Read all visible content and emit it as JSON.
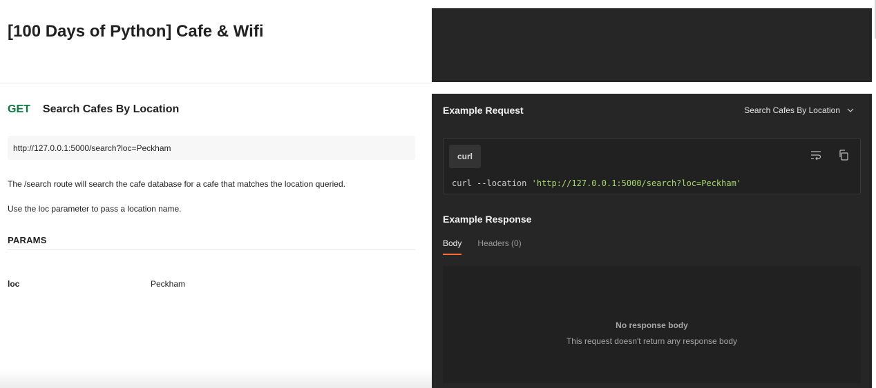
{
  "collection": {
    "title": "[100 Days of Python] Cafe & Wifi"
  },
  "request": {
    "method": "GET",
    "name": "Search Cafes By Location",
    "url": "http://127.0.0.1:5000/search?loc=Peckham",
    "description": [
      "The /search route will search the cafe database for a cafe that matches the location queried.",
      "Use the loc parameter to pass a location name."
    ],
    "params_title": "PARAMS",
    "params": [
      {
        "key": "loc",
        "value": "Peckham"
      }
    ]
  },
  "example_request": {
    "title": "Example Request",
    "selected": "Search Cafes By Location",
    "language": "curl",
    "code": {
      "cmd": "curl ",
      "flag": "--",
      "option": "location ",
      "url": "'http://127.0.0.1:5000/search?loc=Peckham'"
    }
  },
  "example_response": {
    "title": "Example Response",
    "tabs": [
      "Body",
      "Headers (0)"
    ],
    "active_tab": "Body",
    "empty_title": "No response body",
    "empty_subtitle": "This request doesn't return any response body"
  },
  "colors": {
    "get_method": "#0b7a3e",
    "active_tab_underline": "#ff6c37",
    "code_string": "#a6d96a",
    "dark_panel": "#262626"
  },
  "icons": [
    "chevron-down-icon",
    "wrap-lines-icon",
    "copy-icon"
  ]
}
